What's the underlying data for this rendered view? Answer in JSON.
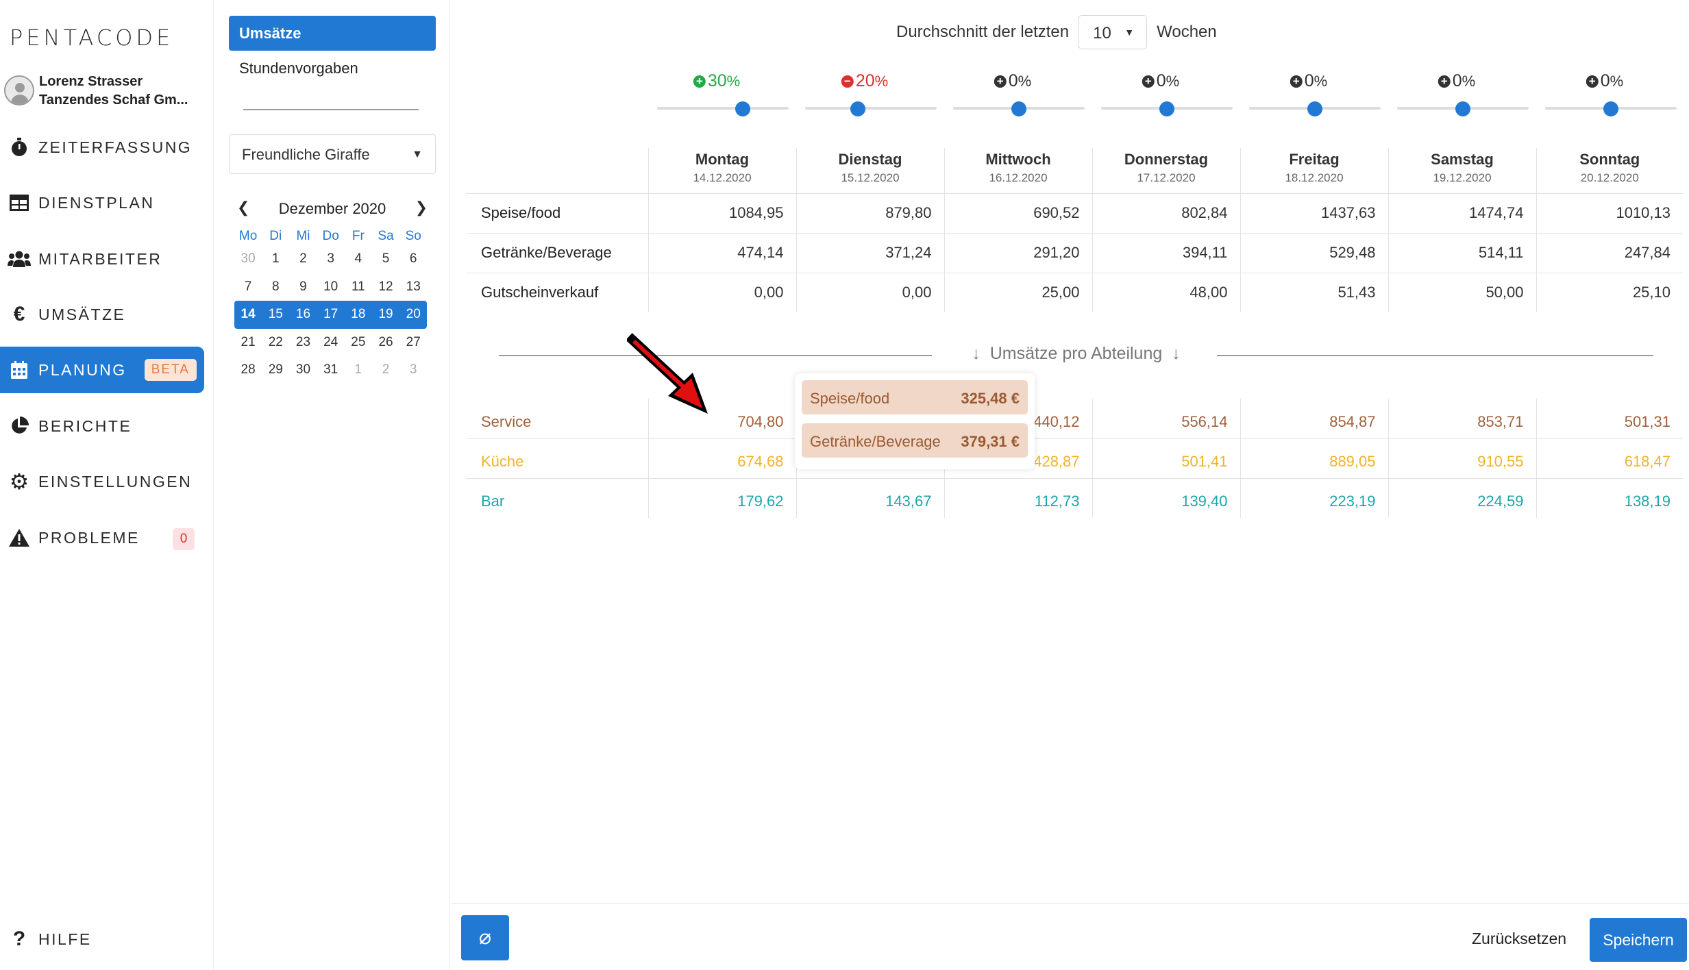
{
  "app": {
    "logo_text": "PENTACODE"
  },
  "user": {
    "name": "Lorenz Strasser",
    "company": "Tanzendes Schaf Gm..."
  },
  "nav": {
    "items": [
      {
        "label": "ZEITERFASSUNG",
        "icon": "stopwatch-icon"
      },
      {
        "label": "DIENSTPLAN",
        "icon": "table-icon"
      },
      {
        "label": "MITARBEITER",
        "icon": "users-icon"
      },
      {
        "label": "UMSÄTZE",
        "icon": "euro-icon"
      },
      {
        "label": "PLANUNG",
        "icon": "calendar-icon",
        "badge": "BETA",
        "active": true
      },
      {
        "label": "BERICHTE",
        "icon": "pie-chart-icon"
      },
      {
        "label": "EINSTELLUNGEN",
        "icon": "gear-icon"
      },
      {
        "label": "PROBLEME",
        "icon": "warning-icon",
        "count": "0"
      }
    ],
    "help_label": "HILFE"
  },
  "subnav": {
    "tabs": [
      {
        "label": "Umsätze",
        "active": true
      },
      {
        "label": "Stundenvorgaben"
      }
    ],
    "location": "Freundliche Giraffe"
  },
  "calendar": {
    "month_label": "Dezember 2020",
    "weekdays": [
      "Mo",
      "Di",
      "Mi",
      "Do",
      "Fr",
      "Sa",
      "So"
    ],
    "weeks": [
      [
        "30",
        "1",
        "2",
        "3",
        "4",
        "5",
        "6"
      ],
      [
        "7",
        "8",
        "9",
        "10",
        "11",
        "12",
        "13"
      ],
      [
        "14",
        "15",
        "16",
        "17",
        "18",
        "19",
        "20"
      ],
      [
        "21",
        "22",
        "23",
        "24",
        "25",
        "26",
        "27"
      ],
      [
        "28",
        "29",
        "30",
        "31",
        "1",
        "2",
        "3"
      ]
    ],
    "selected_week_index": 2
  },
  "average": {
    "prefix": "Durchschnitt der letzten",
    "value": "10",
    "suffix": "Wochen"
  },
  "adjustments": [
    {
      "sign": "+",
      "value": "30",
      "unit": "%",
      "type": "pos"
    },
    {
      "sign": "−",
      "value": "20",
      "unit": "%",
      "type": "neg"
    },
    {
      "sign": "+",
      "value": "0",
      "unit": "%",
      "type": "zero"
    },
    {
      "sign": "+",
      "value": "0",
      "unit": "%",
      "type": "zero"
    },
    {
      "sign": "+",
      "value": "0",
      "unit": "%",
      "type": "zero"
    },
    {
      "sign": "+",
      "value": "0",
      "unit": "%",
      "type": "zero"
    },
    {
      "sign": "+",
      "value": "0",
      "unit": "%",
      "type": "zero"
    }
  ],
  "days": [
    {
      "name": "Montag",
      "date": "14.12.2020"
    },
    {
      "name": "Dienstag",
      "date": "15.12.2020"
    },
    {
      "name": "Mittwoch",
      "date": "16.12.2020"
    },
    {
      "name": "Donnerstag",
      "date": "17.12.2020"
    },
    {
      "name": "Freitag",
      "date": "18.12.2020"
    },
    {
      "name": "Samstag",
      "date": "19.12.2020"
    },
    {
      "name": "Sonntag",
      "date": "20.12.2020"
    }
  ],
  "revenue_rows": [
    {
      "label": "Speise/food",
      "values": [
        "1084,95",
        "879,80",
        "690,52",
        "802,84",
        "1437,63",
        "1474,74",
        "1010,13"
      ]
    },
    {
      "label": "Getränke/Beverage",
      "values": [
        "474,14",
        "371,24",
        "291,20",
        "394,11",
        "529,48",
        "514,11",
        "247,84"
      ]
    },
    {
      "label": "Gutscheinverkauf",
      "values": [
        "0,00",
        "0,00",
        "25,00",
        "48,00",
        "51,43",
        "50,00",
        "25,10"
      ]
    }
  ],
  "department_divider": "Umsätze pro Abteilung",
  "department_rows": [
    {
      "label": "Service",
      "color": "#a0613c",
      "values": [
        "704,80",
        "",
        "440,12",
        "556,14",
        "854,87",
        "853,71",
        "501,31"
      ]
    },
    {
      "label": "Küche",
      "color": "#f0b32c",
      "values": [
        "674,68",
        "",
        "428,87",
        "501,41",
        "889,05",
        "910,55",
        "618,47"
      ]
    },
    {
      "label": "Bar",
      "color": "#1aa5a8",
      "values": [
        "179,62",
        "143,67",
        "112,73",
        "139,40",
        "223,19",
        "224,59",
        "138,19"
      ]
    }
  ],
  "tooltip": {
    "rows": [
      {
        "label": "Speise/food",
        "value": "325,48 €"
      },
      {
        "label": "Getränke/Beverage",
        "value": "379,31 €"
      }
    ]
  },
  "footer": {
    "clear_symbol": "⌀",
    "reset_label": "Zurücksetzen",
    "save_label": "Speichern"
  }
}
